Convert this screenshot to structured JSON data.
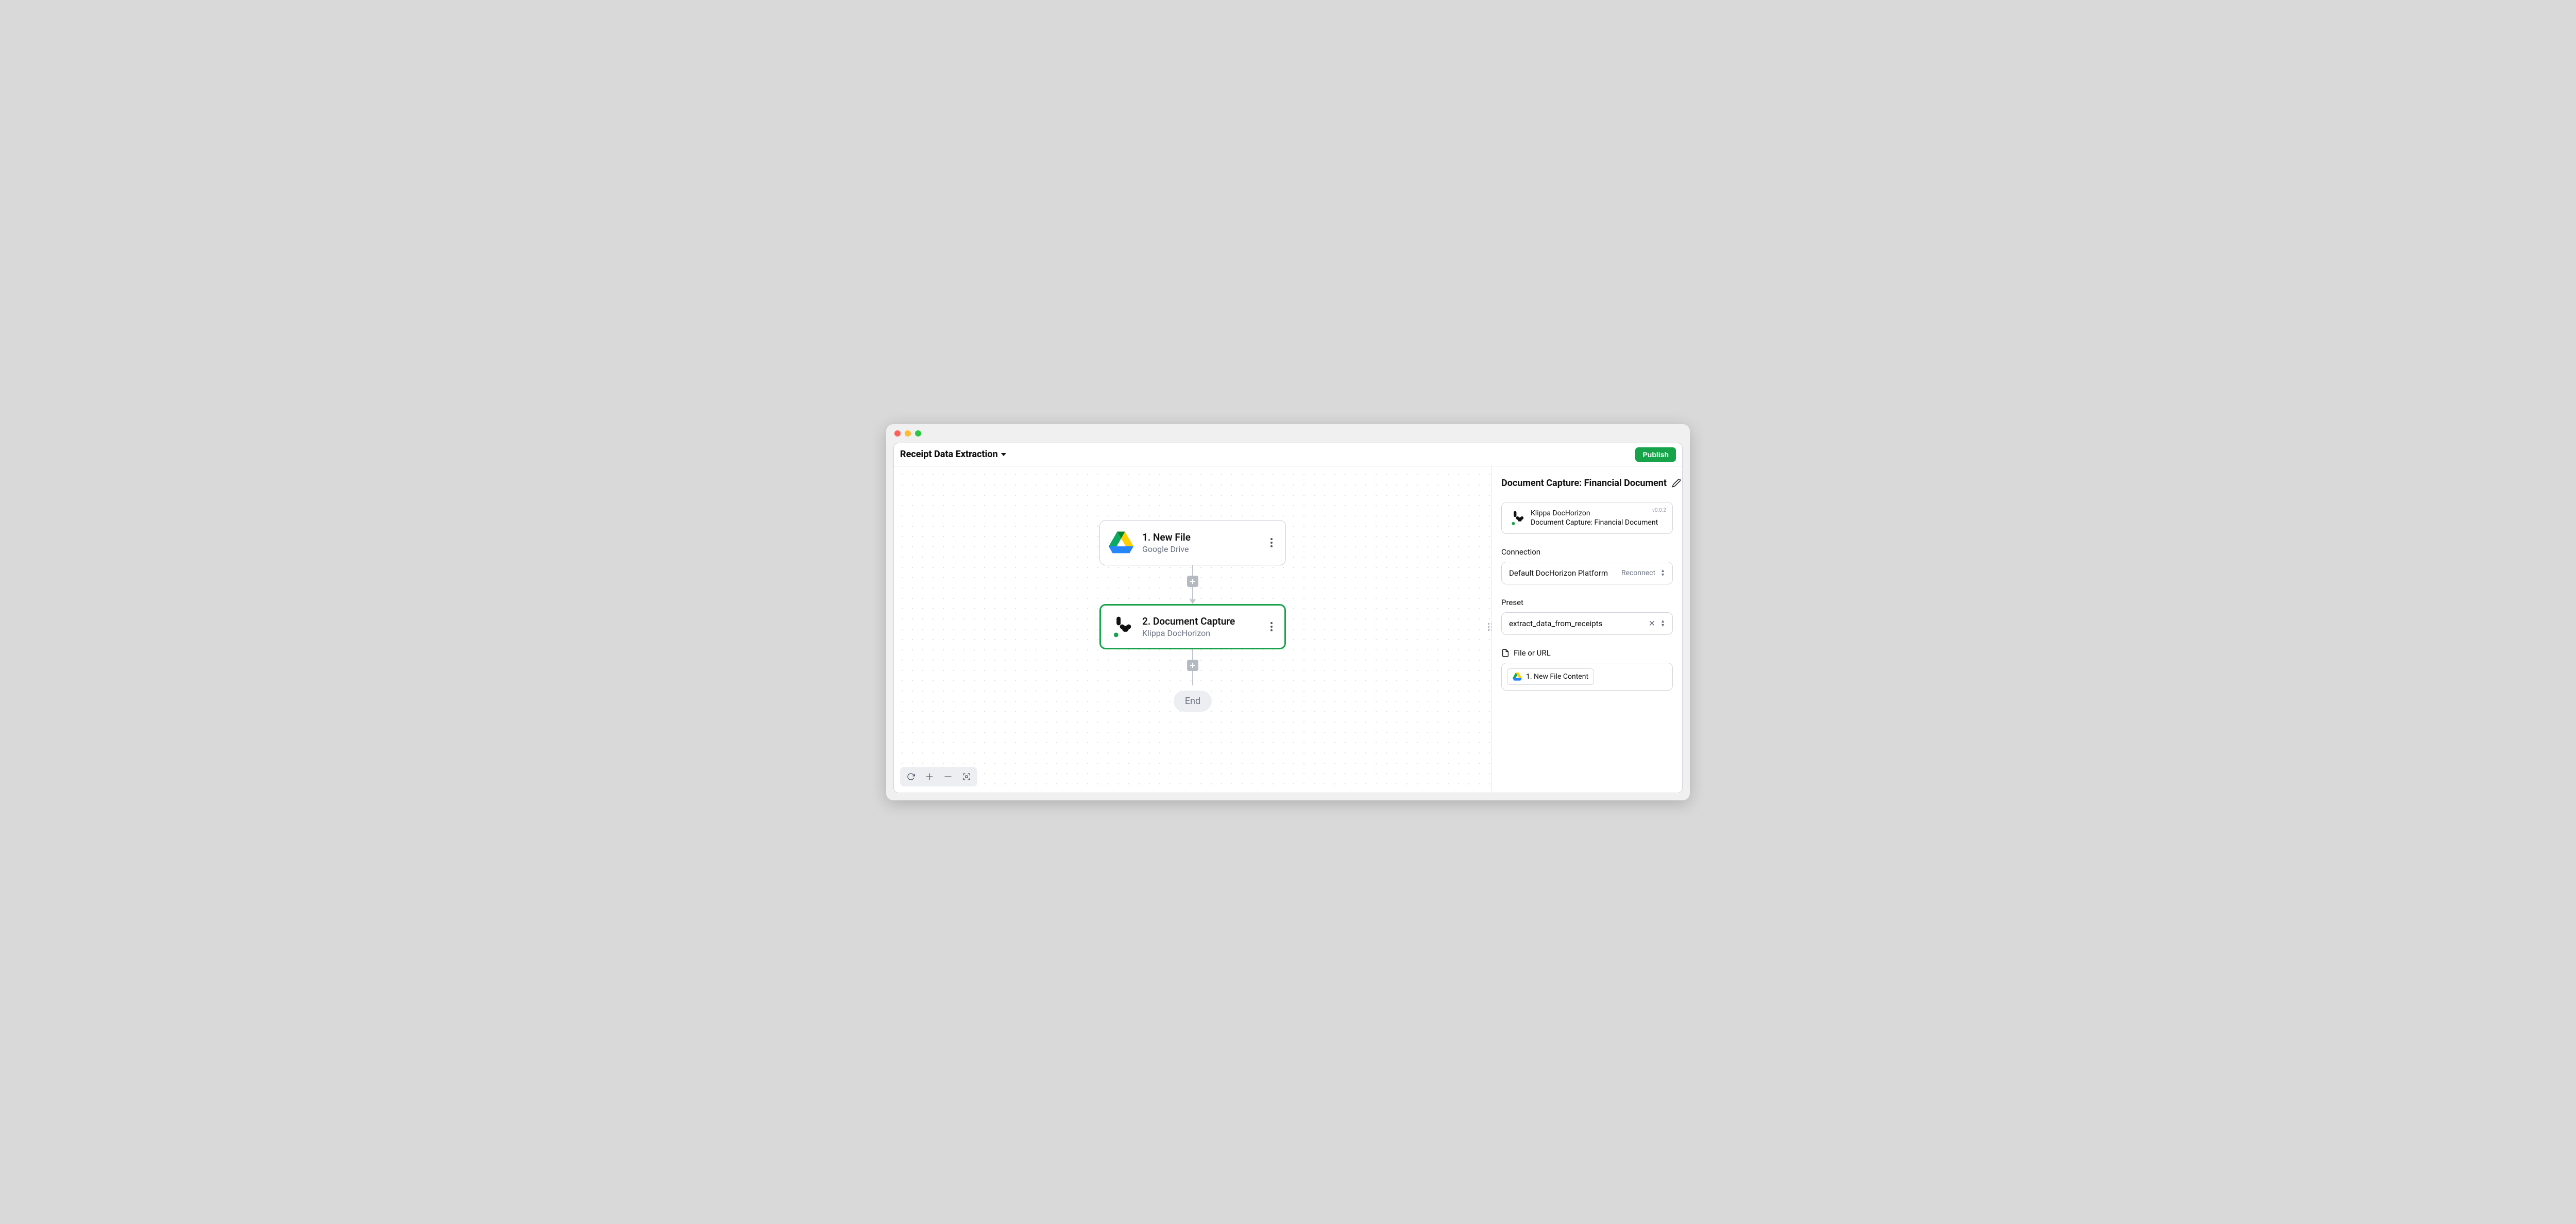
{
  "window": {},
  "toolbar": {
    "flow_title": "Receipt Data Extraction",
    "publish_label": "Publish"
  },
  "canvas": {
    "nodes": [
      {
        "title": "1. New File",
        "subtitle": "Google Drive",
        "selected": false
      },
      {
        "title": "2. Document Capture",
        "subtitle": "Klippa DocHorizon",
        "selected": true
      }
    ],
    "end_label": "End"
  },
  "details": {
    "title": "Document Capture: Financial Document",
    "info": {
      "line1": "Klippa DocHorizon",
      "line2": "Document Capture: Financial Document",
      "version": "v0.0.2"
    },
    "connection": {
      "label": "Connection",
      "value": "Default DocHorizon Platform",
      "action": "Reconnect"
    },
    "preset": {
      "label": "Preset",
      "value": "extract_data_from_receipts"
    },
    "file": {
      "label": "File or URL",
      "chip": "1. New File Content"
    }
  }
}
